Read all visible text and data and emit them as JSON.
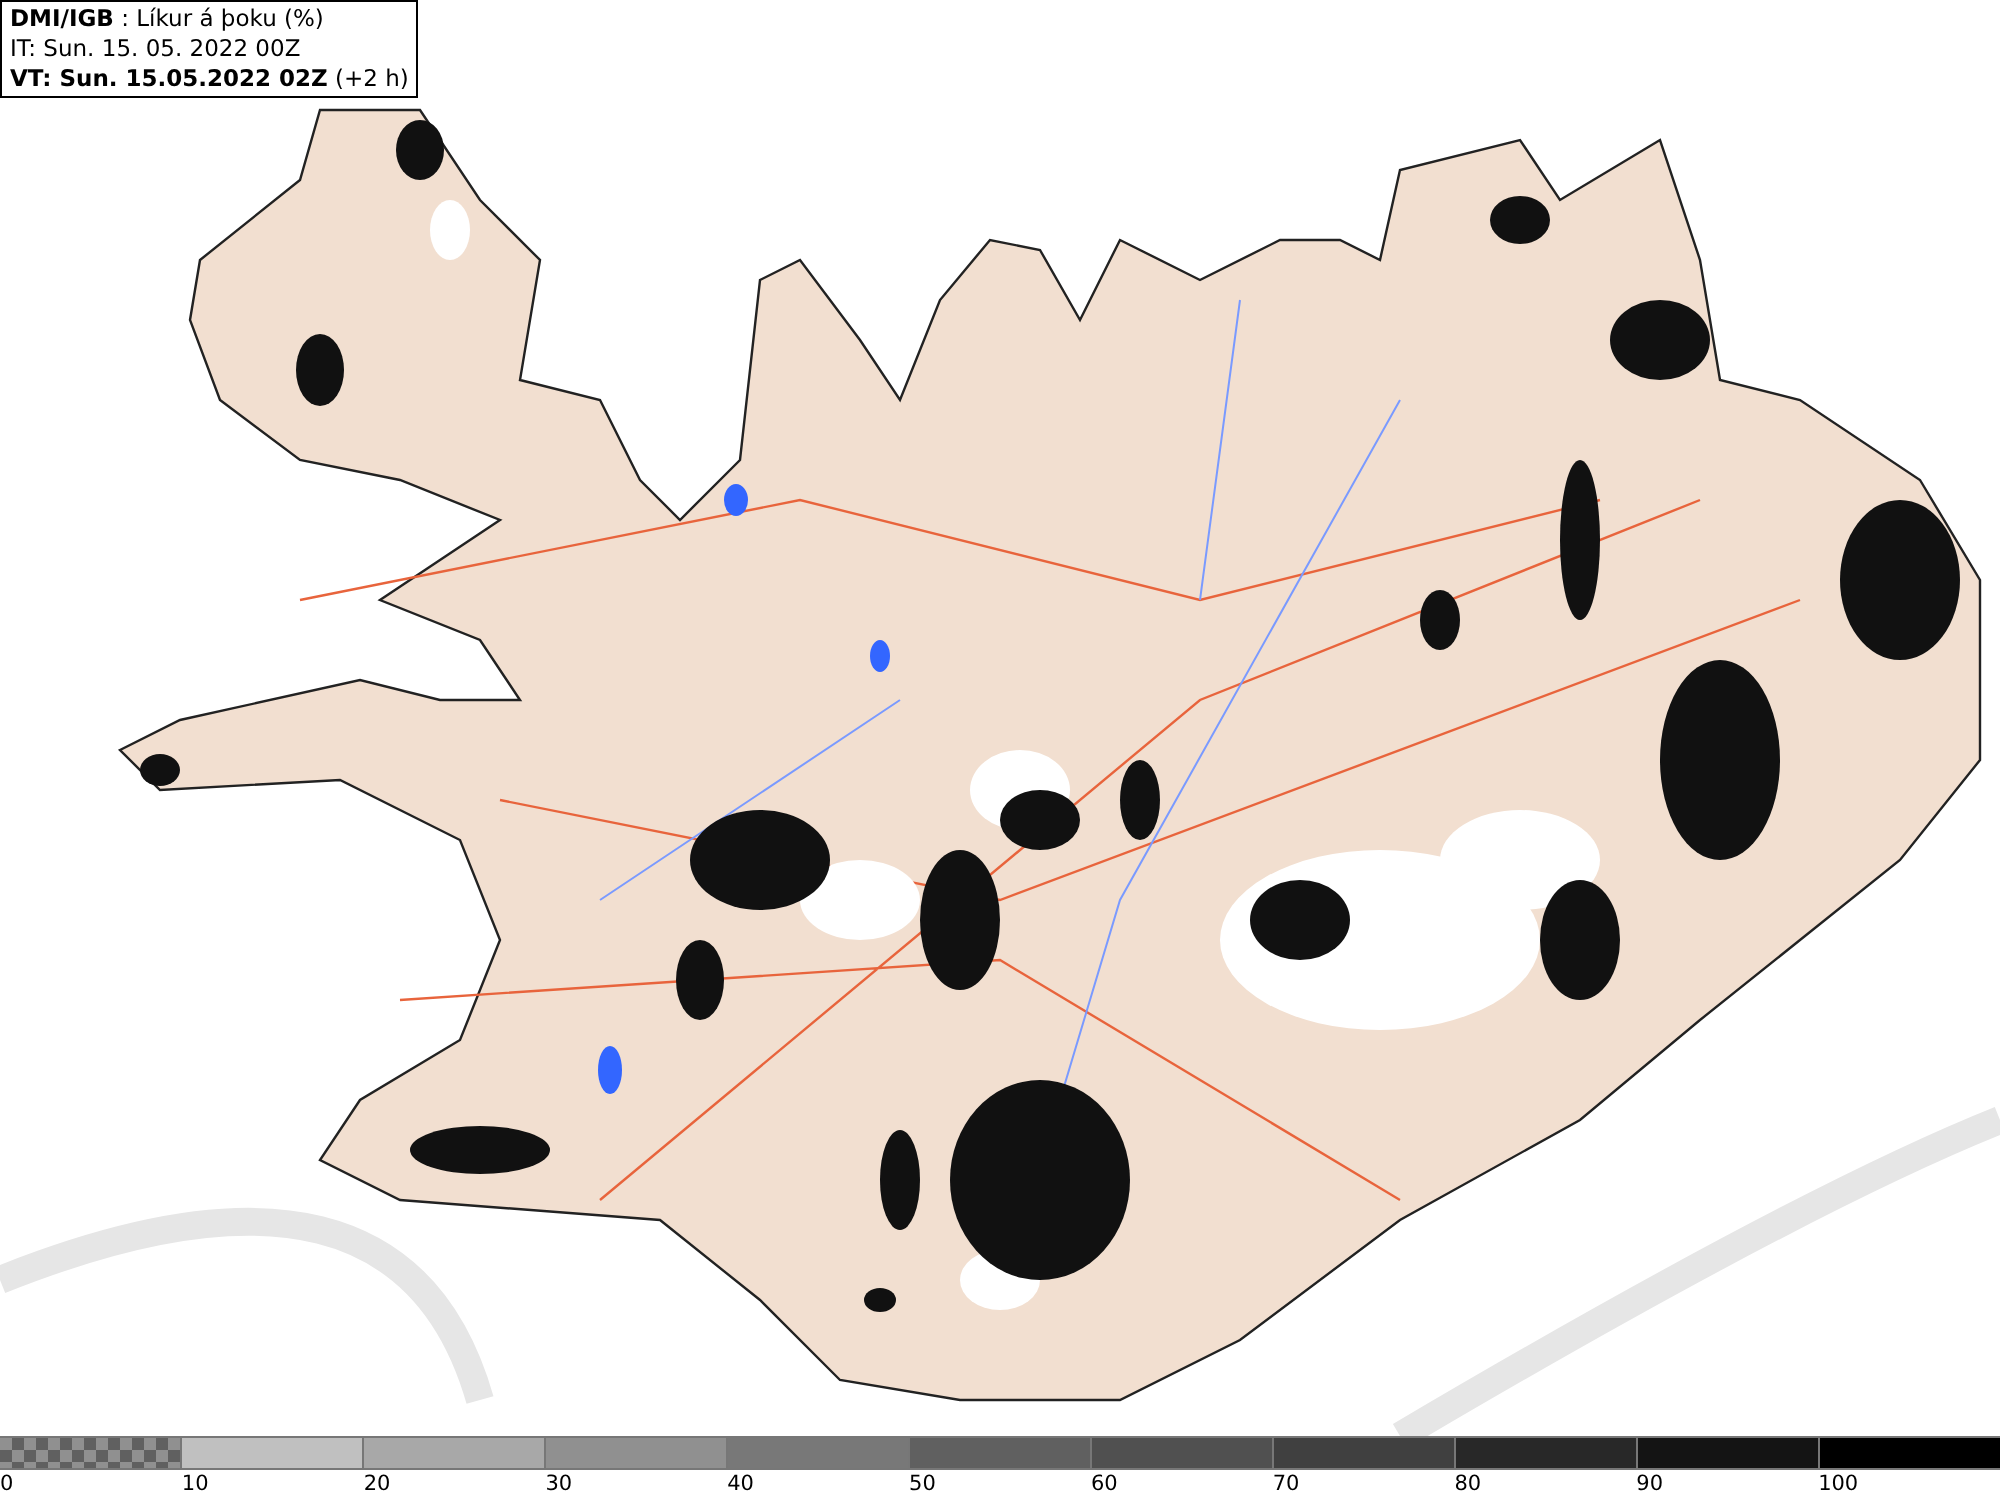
{
  "header": {
    "title": "**DMI/IGB** : Líkur á þoku (%)",
    "issue_time": "IT: Sun. 15. 05. 2022 00Z",
    "valid_time": "**VT: Sun. 15.05.2022 02Z** (+2 h)"
  },
  "legend": [
    {
      "label": "0",
      "kind": "pattern",
      "color": "#606060"
    },
    {
      "label": "10",
      "kind": "solid",
      "color": "#c0c0c0"
    },
    {
      "label": "20",
      "kind": "solid",
      "color": "#a8a8a8"
    },
    {
      "label": "30",
      "kind": "solid",
      "color": "#909090"
    },
    {
      "label": "40",
      "kind": "solid",
      "color": "#787878"
    },
    {
      "label": "50",
      "kind": "solid",
      "color": "#606060"
    },
    {
      "label": "60",
      "kind": "solid",
      "color": "#505050"
    },
    {
      "label": "70",
      "kind": "solid",
      "color": "#404040"
    },
    {
      "label": "80",
      "kind": "solid",
      "color": "#282828"
    },
    {
      "label": "90",
      "kind": "solid",
      "color": "#141414"
    },
    {
      "label": "100",
      "kind": "solid",
      "color": "#000000"
    }
  ]
}
